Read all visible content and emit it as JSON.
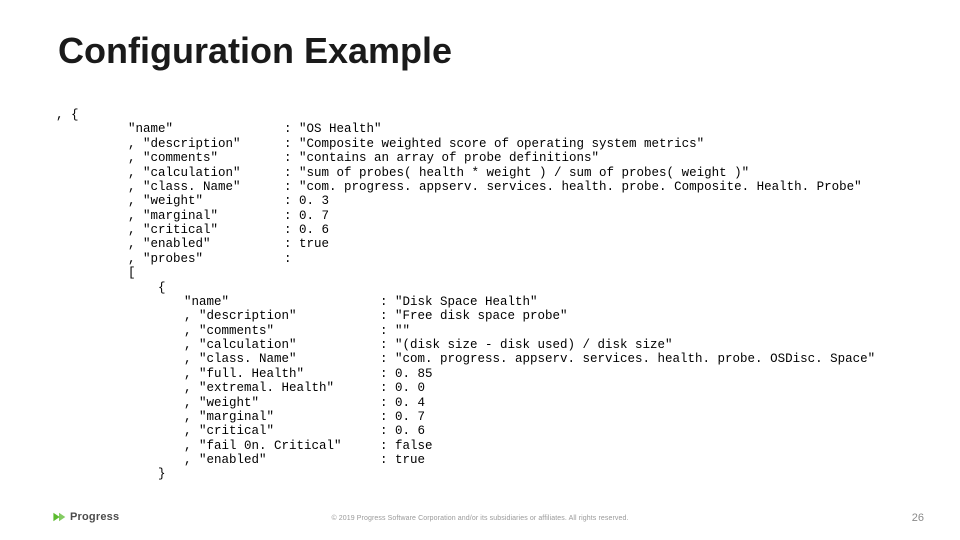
{
  "title": "Configuration Example",
  "code": {
    "open_line": ", {",
    "outer_key_col_width": 228,
    "outer": [
      {
        "key": "\"name\"",
        "val": ": \"OS Health\""
      },
      {
        "key": ", \"description\"",
        "val": ": \"Composite weighted score of operating system metrics\""
      },
      {
        "key": ", \"comments\"",
        "val": ": \"contains an array of probe definitions\""
      },
      {
        "key": ", \"calculation\"",
        "val": ": \"sum of probes( health * weight ) / sum of probes( weight )\""
      },
      {
        "key": ", \"class. Name\"",
        "val": ": \"com. progress. appserv. services. health. probe. Composite. Health. Probe\""
      },
      {
        "key": ", \"weight\"",
        "val": ": 0. 3"
      },
      {
        "key": ", \"marginal\"",
        "val": ": 0. 7"
      },
      {
        "key": ", \"critical\"",
        "val": ": 0. 6"
      },
      {
        "key": ", \"enabled\"",
        "val": ": true"
      },
      {
        "key": ", \"probes\"",
        "val": ":"
      }
    ],
    "bracket_open": "[",
    "inner_open": "    {",
    "inner_key_col_width": 196,
    "inner_key_indent": 56,
    "inner_val_indent": 40,
    "inner": [
      {
        "key": "\"name\"",
        "val": ": \"Disk Space Health\""
      },
      {
        "key": ", \"description\"",
        "val": ": \"Free disk space probe\""
      },
      {
        "key": ", \"comments\"",
        "val": ": \"\""
      },
      {
        "key": ", \"calculation\"",
        "val": ": \"(disk size - disk used) / disk size\""
      },
      {
        "key": ", \"class. Name\"",
        "val": ": \"com. progress. appserv. services. health. probe. OSDisc. Space\""
      },
      {
        "key": ", \"full. Health\"",
        "val": ": 0. 85"
      },
      {
        "key": ", \"extremal. Health\"",
        "val": ": 0. 0"
      },
      {
        "key": ", \"weight\"",
        "val": ": 0. 4"
      },
      {
        "key": ", \"marginal\"",
        "val": ": 0. 7"
      },
      {
        "key": ", \"critical\"",
        "val": ": 0. 6"
      },
      {
        "key": ", \"fail 0n. Critical\"",
        "val": ": false"
      },
      {
        "key": ", \"enabled\"",
        "val": ": true"
      }
    ],
    "inner_close": "    }"
  },
  "footer": {
    "logo_text": "Progress",
    "copyright": "© 2019 Progress Software Corporation and/or its subsidiaries or affiliates. All rights reserved.",
    "page_number": "26",
    "brand_color": "#5bbb2f"
  }
}
